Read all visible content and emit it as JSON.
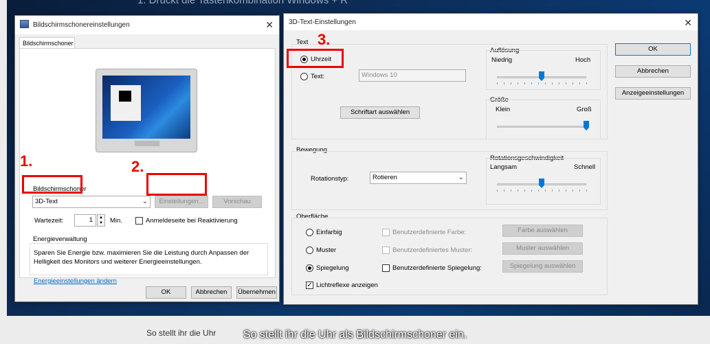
{
  "background": {
    "top_text": "1. Drückt die Tastenkombination Windows + R",
    "bottom_text": "So stellt ihr die Uhr",
    "caption": "So stellt ihr die Uhr als Bildschirmschoner ein."
  },
  "annotations": {
    "step1": "1.",
    "step2": "2.",
    "step3": "3."
  },
  "saver_window": {
    "title": "Bildschirmschonereinstellungen",
    "close": "✕",
    "tab": "Bildschirmschoner",
    "group_label": "Bildschirmschoner",
    "saver_select_value": "3D-Text",
    "settings_button": "Einstellungen...",
    "preview_button": "Vorschau",
    "wait_label": "Wartezeit:",
    "wait_value": "1",
    "wait_unit": "Min.",
    "logon_checkbox": "Anmeldeseite bei Reaktivierung",
    "energy_title": "Energieverwaltung",
    "energy_text": "Sparen Sie Energie bzw. maximieren Sie die Leistung durch Anpassen der Helligkeit des Monitors und weiterer Energieeinstellungen.",
    "energy_link": "Energieeinstellungen ändern",
    "ok": "OK",
    "cancel": "Abbrechen",
    "apply": "Übernehmen"
  },
  "text3d_window": {
    "title": "3D-Text-Einstellungen",
    "close": "✕",
    "text_group": "Text",
    "radio_time": "Uhrzeit",
    "radio_text": "Text:",
    "text_value": "Windows 10",
    "font_button": "Schriftart auswählen",
    "resolution_group": "Auflösung",
    "resolution_low": "Niedrig",
    "resolution_high": "Hoch",
    "resolution_level": 0.5,
    "size_group": "Größe",
    "size_small": "Klein",
    "size_large": "Groß",
    "size_level": 1.0,
    "motion_group": "Bewegung",
    "rotation_label": "Rotationstyp:",
    "rotation_value": "Rotieren",
    "speed_group": "Rotationsgeschwindigkeit",
    "speed_slow": "Langsam",
    "speed_fast": "Schnell",
    "speed_level": 0.5,
    "surface_group": "Oberfläche",
    "surf_solid": "Einfarbig",
    "surf_pattern": "Muster",
    "surf_mirror": "Spiegelung",
    "custom_color": "Benutzerdefinierte Farbe:",
    "custom_pattern": "Benutzerdefiniertes Muster:",
    "custom_mirror": "Benutzerdefinierte Spiegelung:",
    "choose_color": "Farbe auswählen",
    "choose_pattern": "Muster auswählen",
    "choose_mirror": "Spiegelung auswählen",
    "highlights": "Lichtreflexe anzeigen",
    "ok": "OK",
    "cancel": "Abbrechen",
    "display_settings": "Anzeigeeinstellungen"
  },
  "colors": {
    "accent": "#0078d7",
    "annotation": "#e00000"
  }
}
